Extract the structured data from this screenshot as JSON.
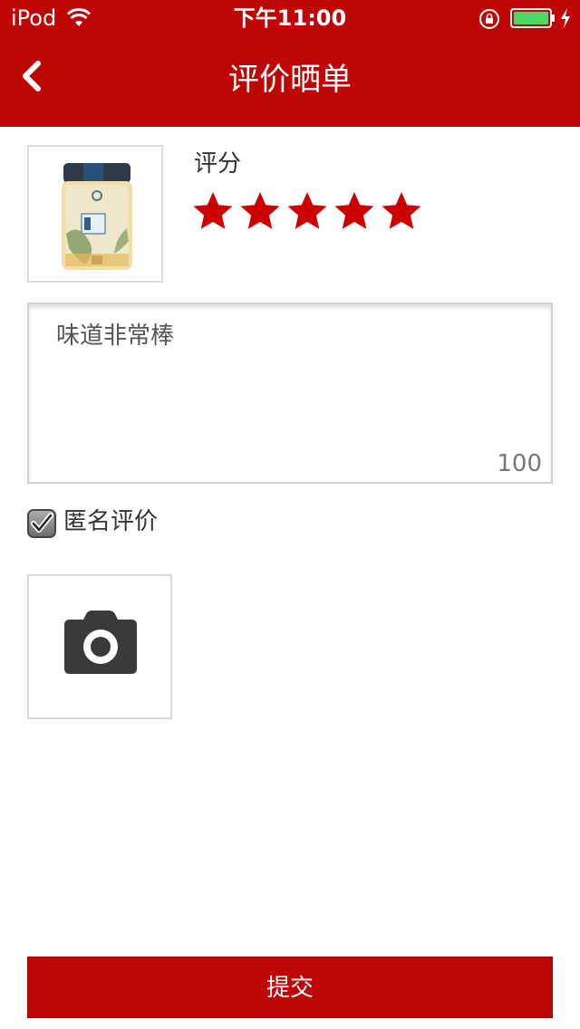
{
  "status_bar": {
    "carrier": "iPod",
    "time": "下午11:00",
    "battery_color": "#4cd964"
  },
  "nav": {
    "title": "评价晒单",
    "back_icon": "chevron-left-icon",
    "bar_color": "#bf0607"
  },
  "product": {
    "image_icon": "honey-jar-image"
  },
  "rating": {
    "label": "评分",
    "value": 5,
    "max": 5,
    "star_color": "#cc0000"
  },
  "comment": {
    "text": "味道非常棒",
    "char_count": "100"
  },
  "anonymous": {
    "label": "匿名评价",
    "checked": true
  },
  "photo_upload": {
    "icon": "camera-icon"
  },
  "submit": {
    "label": "提交"
  }
}
